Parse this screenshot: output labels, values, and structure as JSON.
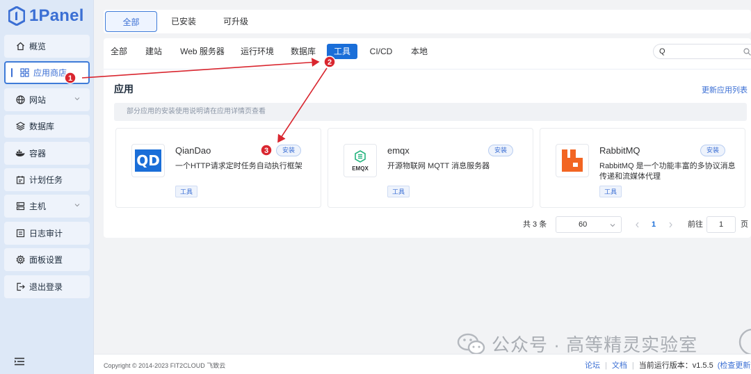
{
  "brand": {
    "name": "1Panel",
    "color": "#3b6fd4"
  },
  "sidebar": {
    "items": [
      {
        "label": "概览",
        "icon": "home-icon"
      },
      {
        "label": "应用商店",
        "icon": "grid-icon",
        "active": true
      },
      {
        "label": "网站",
        "icon": "globe-icon",
        "has_children": true
      },
      {
        "label": "数据库",
        "icon": "layers-icon"
      },
      {
        "label": "容器",
        "icon": "docker-icon"
      },
      {
        "label": "计划任务",
        "icon": "calendar-icon"
      },
      {
        "label": "主机",
        "icon": "server-icon",
        "has_children": true
      },
      {
        "label": "日志审计",
        "icon": "log-icon"
      },
      {
        "label": "面板设置",
        "icon": "gear-icon"
      },
      {
        "label": "退出登录",
        "icon": "logout-icon"
      }
    ]
  },
  "top_tabs": [
    {
      "label": "全部",
      "active": true
    },
    {
      "label": "已安装"
    },
    {
      "label": "可升级"
    }
  ],
  "filters": [
    {
      "label": "全部"
    },
    {
      "label": "建站"
    },
    {
      "label": "Web 服务器"
    },
    {
      "label": "运行环境"
    },
    {
      "label": "数据库"
    },
    {
      "label": "工具",
      "active": true
    },
    {
      "label": "CI/CD"
    },
    {
      "label": "本地"
    }
  ],
  "search": {
    "value": "Q"
  },
  "apps_section": {
    "title": "应用",
    "refresh_label": "更新应用列表",
    "notice": "部分应用的安装使用说明请在应用详情页查看"
  },
  "apps": [
    {
      "name": "QianDao",
      "logo_text": "QD",
      "description": "一个HTTP请求定时任务自动执行框架",
      "install_label": "安装",
      "tag": "工具"
    },
    {
      "name": "emqx",
      "logo_text": "EMQX",
      "description": "开源物联网 MQTT 消息服务器",
      "install_label": "安装",
      "tag": "工具"
    },
    {
      "name": "RabbitMQ",
      "description": "RabbitMQ 是一个功能丰富的多协议消息传递和流媒体代理",
      "install_label": "安装",
      "tag": "工具"
    }
  ],
  "pagination": {
    "total_label": "共 3 条",
    "page_size": "60",
    "current_page": "1",
    "goto_label": "前往",
    "goto_value": "1",
    "page_suffix": "页"
  },
  "footer": {
    "copyright": "Copyright © 2014-2023 FIT2CLOUD 飞致云",
    "forum": "论坛",
    "docs": "文档",
    "version_label": "当前运行版本：v1.5.5",
    "check_update": "(检查更新)"
  },
  "annotations": [
    "1",
    "2",
    "3"
  ],
  "watermark": "公众号 · 高等精灵实验室",
  "colors": {
    "accent": "#1a6ed8",
    "arrow": "#d9262f"
  }
}
